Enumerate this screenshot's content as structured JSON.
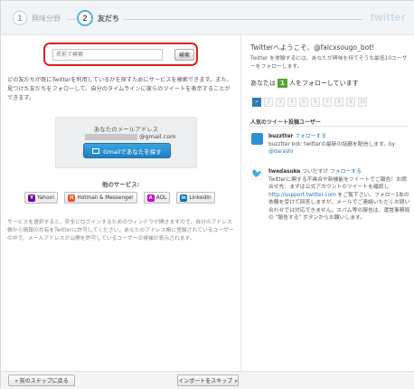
{
  "steps": [
    {
      "number": "1",
      "label": "興味分野"
    },
    {
      "number": "2",
      "label": "友だち"
    }
  ],
  "brand": "twitter",
  "search": {
    "placeholder": "名前で検索",
    "button_label": "検索"
  },
  "intro_text": "どの友だちが既にTwitterを利用しているかを探すためにサービスを検索できます。また、見つけた友だちをフォローして、自分のタイムラインに彼らのツイートを表示することができます。",
  "mail": {
    "title": "あなたのメールアドレス",
    "domain": "@gmail.com",
    "button_label": "Gmailであなたを探す"
  },
  "services": {
    "title": "他のサービス:",
    "items": [
      {
        "label": "Yahoo!",
        "icon": "yahoo-icon",
        "color": "#7b0099"
      },
      {
        "label": "Hotmail & Messenger",
        "icon": "messenger-icon",
        "color": "#f25022"
      },
      {
        "label": "AOL",
        "icon": "aol-icon",
        "color": "#cc00cc"
      },
      {
        "label": "LinkedIn",
        "icon": "linkedin-icon",
        "color": "#0077b5"
      }
    ]
  },
  "disclaimer": "サービスを選択すると、安全にログインするためのウィンドウが開きますので、自分のアドレス帳から情報の共有をTwitterに許可してください。あなたのアドレス帳に登録されているユーザーの中で、メールアドレスが公開を許可しているユーザーの候補が表示されます。",
  "right": {
    "welcome": "Twitterへようこそ、@falcxsougo_bot!",
    "subtitle": "Twitter を体験するには、あなたが興味を持てそうな最低10ユーザーをフォローします。",
    "follow_prefix": "あなたは",
    "follow_count": "1",
    "follow_suffix": "人をフォローしています",
    "ticks": [
      "2",
      "3",
      "4",
      "5",
      "6",
      "7",
      "8",
      "9",
      "10"
    ],
    "popular_title": "人気のツイート投稿ユーザー",
    "users": [
      {
        "name": "buzztter",
        "follow_label": "フォローする",
        "bio": "buzztter bot: twitterの最新の話題を配信します。by",
        "link": "@darashi",
        "avatar_color": "#2f8fd6"
      },
      {
        "name": "twedasuke",
        "handle": "ついだすけ",
        "follow_label": "フォローする",
        "bio": "Twitterに関する不具合や新機能をツイートでご報告！お問合せ先：まずは公式アカウントのツイートを確認し",
        "link": "http://support.twitter.com",
        "bio2": "をご覧下さい。フォロー1本の依頼を受けて回答しますが、メールでご連絡いただくお問い合わせでは対応できません。スパム等の報告は、運営事務局の \"報告する\" ボタンからお願いします。",
        "avatar_color": "#ffffff"
      }
    ]
  },
  "bottom": {
    "back_label": "« 前のステップに戻る",
    "skip_label": "インポートをスキップ »"
  }
}
